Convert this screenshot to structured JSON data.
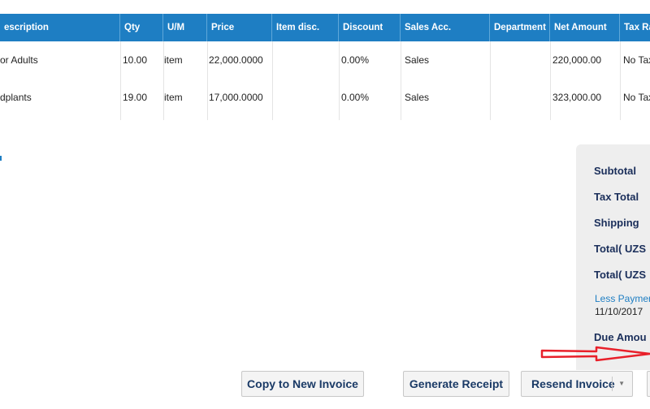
{
  "table": {
    "columns": [
      {
        "label": "escription"
      },
      {
        "label": "Qty"
      },
      {
        "label": "U/M"
      },
      {
        "label": "Price"
      },
      {
        "label": "Item disc."
      },
      {
        "label": "Discount"
      },
      {
        "label": "Sales Acc."
      },
      {
        "label": "Department"
      },
      {
        "label": "Net Amount"
      },
      {
        "label": "Tax Ra"
      }
    ],
    "rows": [
      {
        "description": "or Adults",
        "qty": "10.00",
        "um": "item",
        "price": "22,000.0000",
        "item_disc": "",
        "discount": "0.00%",
        "sales_acc": "Sales",
        "department": "",
        "net_amount": "220,000.00",
        "tax_rate": "No Tax"
      },
      {
        "description": "dplants",
        "qty": "19.00",
        "um": "item",
        "price": "17,000.0000",
        "item_disc": "",
        "discount": "0.00%",
        "sales_acc": "Sales",
        "department": "",
        "net_amount": "323,000.00",
        "tax_rate": "No Tax"
      }
    ]
  },
  "totals": {
    "subtotal_label": "Subtotal",
    "tax_total_label": "Tax Total",
    "shipping_label": "Shipping",
    "total_label_1": "Total( UZS",
    "total_label_2": "Total( UZS",
    "less_payments_label": "Less Payment",
    "payment_date": "11/10/2017",
    "due_amount_label": "Due Amou"
  },
  "buttons": {
    "copy_label": "Copy to New Invoice",
    "generate_label": "Generate Receipt",
    "resend_label": "Resend Invoice"
  },
  "colors": {
    "header_bg": "#1e7ec3",
    "totals_bg": "#eeeeee",
    "arrow": "#e8202a"
  }
}
